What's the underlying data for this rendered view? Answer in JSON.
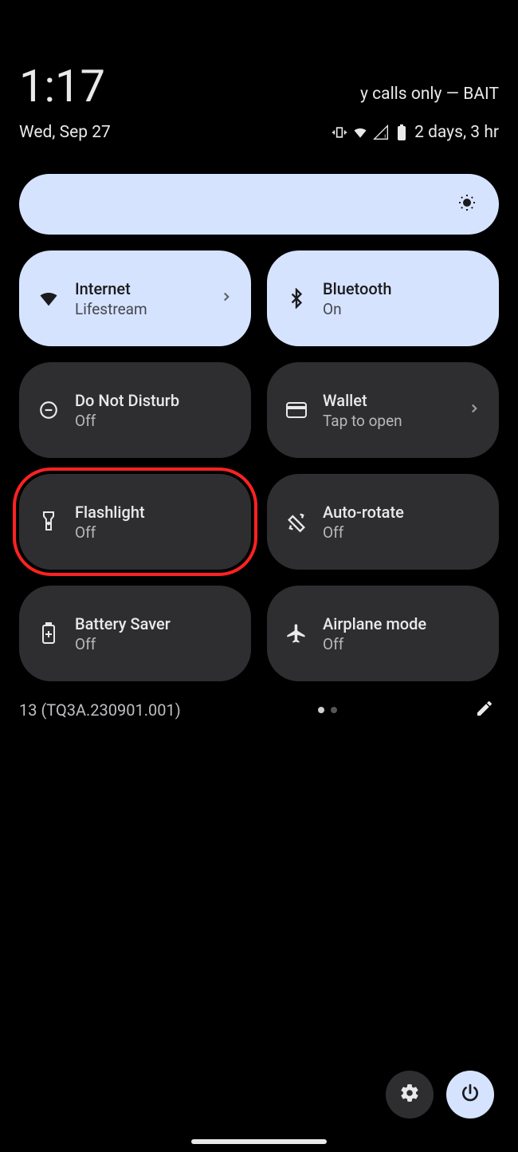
{
  "header": {
    "time": "1:17",
    "carrier": "y calls only — BAIT",
    "date": "Wed, Sep 27",
    "battery_text": "2 days, 3 hr"
  },
  "tiles": [
    {
      "id": "internet",
      "title": "Internet",
      "sub": "Lifestream",
      "active": true,
      "chevron": true
    },
    {
      "id": "bluetooth",
      "title": "Bluetooth",
      "sub": "On",
      "active": true,
      "chevron": false
    },
    {
      "id": "dnd",
      "title": "Do Not Disturb",
      "sub": "Off",
      "active": false,
      "chevron": false
    },
    {
      "id": "wallet",
      "title": "Wallet",
      "sub": "Tap to open",
      "active": false,
      "chevron": true
    },
    {
      "id": "flashlight",
      "title": "Flashlight",
      "sub": "Off",
      "active": false,
      "highlighted": true,
      "chevron": false
    },
    {
      "id": "autorotate",
      "title": "Auto-rotate",
      "sub": "Off",
      "active": false,
      "chevron": false
    },
    {
      "id": "battery-saver",
      "title": "Battery Saver",
      "sub": "Off",
      "active": false,
      "chevron": false
    },
    {
      "id": "airplane",
      "title": "Airplane mode",
      "sub": "Off",
      "active": false,
      "chevron": false
    }
  ],
  "footer": {
    "build": "13 (TQ3A.230901.001)"
  }
}
